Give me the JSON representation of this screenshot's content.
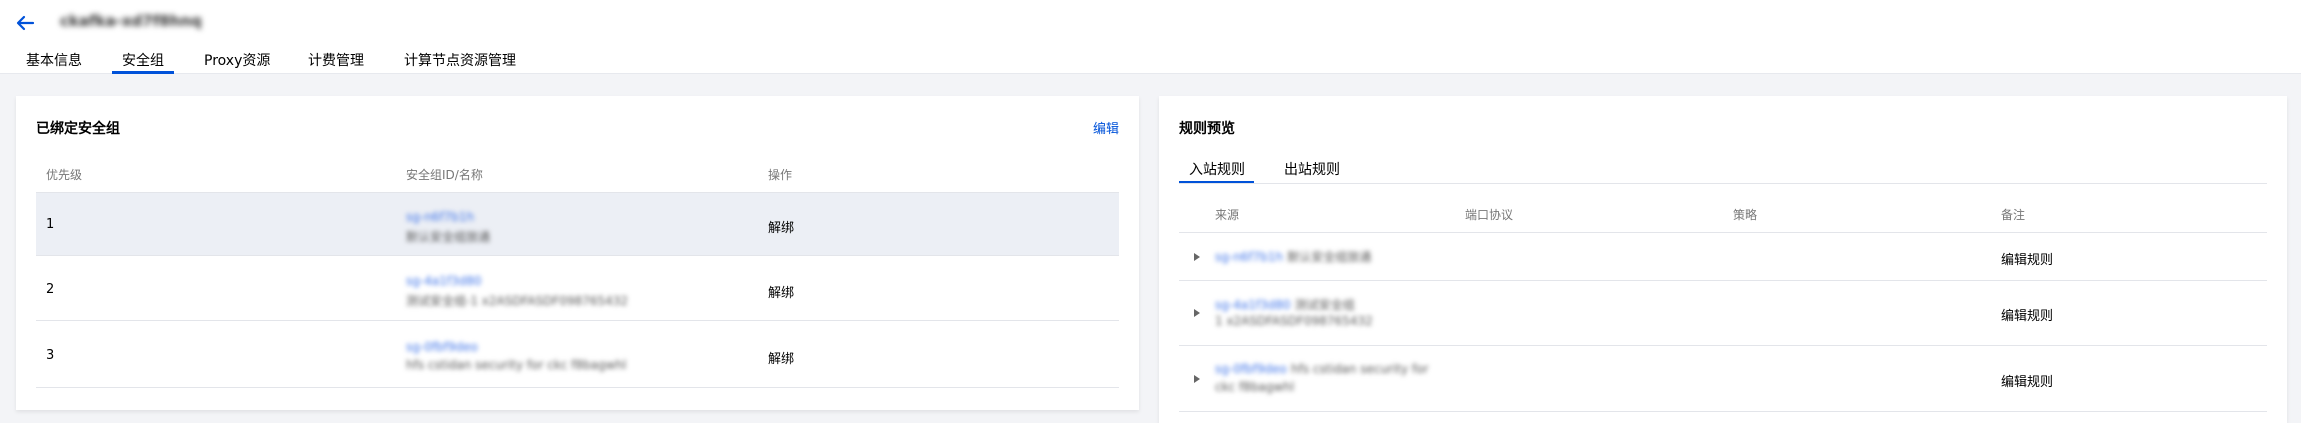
{
  "header": {
    "title": "ckafka-xd7f8hnq",
    "tabs": [
      "基本信息",
      "安全组",
      "Proxy资源",
      "计费管理",
      "计算节点资源管理"
    ],
    "active_tab": 1
  },
  "bound_panel": {
    "title": "已绑定安全组",
    "edit_label": "编辑",
    "columns": [
      "优先级",
      "安全组ID/名称",
      "操作"
    ],
    "rows": [
      {
        "priority": "1",
        "id": "sg-n6f7b1h",
        "name": "默认安全组放通",
        "action": "解绑"
      },
      {
        "priority": "2",
        "id": "sg-4a1f3d80",
        "name": "测试安全组-1 x2ASDFASDF098765432",
        "action": "解绑"
      },
      {
        "priority": "3",
        "id": "sg-0fbf9deo",
        "name": "hfs cstidan security for ckc f8bagwhl",
        "action": "解绑"
      }
    ]
  },
  "preview_panel": {
    "title": "规则预览",
    "subtabs": [
      "入站规则",
      "出站规则"
    ],
    "active_subtab": 0,
    "columns": [
      "来源",
      "端口协议",
      "策略",
      "备注"
    ],
    "rows": [
      {
        "source_id": "sg-n6f7b1h",
        "source_name": "默认安全组放通",
        "source_extra": "",
        "action": "编辑规则"
      },
      {
        "source_id": "sg-4a1f3d80",
        "source_name": "测试安全组",
        "source_extra": "1 x2ASDFASDF098765432",
        "action": "编辑规则"
      },
      {
        "source_id": "sg-0fbf9deo",
        "source_name": "hfs cstidan security for",
        "source_extra": "ckc f8bagwhl",
        "action": "编辑规则"
      }
    ]
  },
  "colors": {
    "accent": "#0052d9",
    "background": "#f3f4f7",
    "highlight_row": "#eceff5"
  }
}
